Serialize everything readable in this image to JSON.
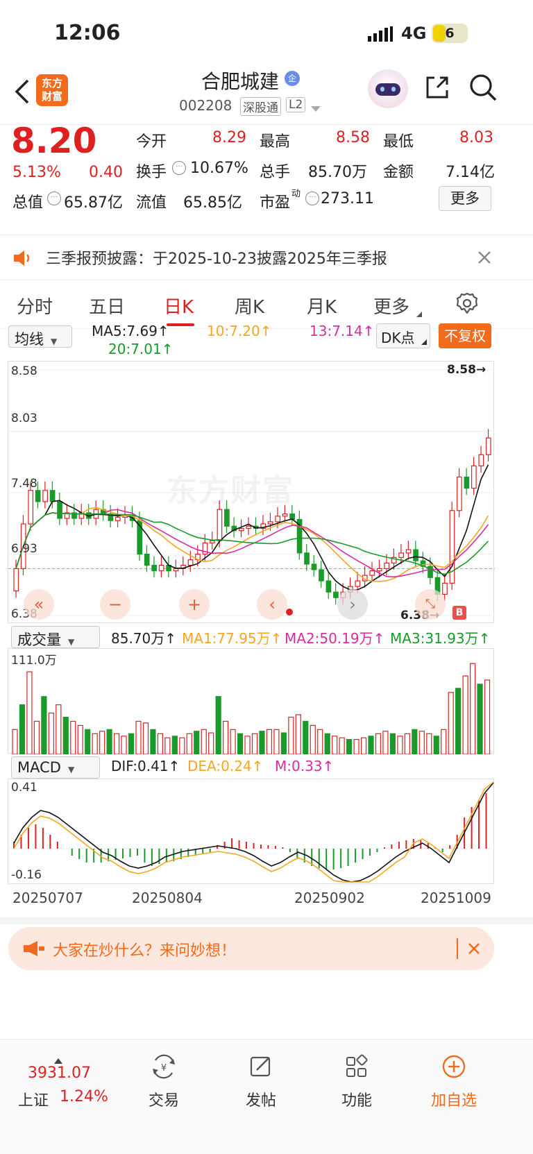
{
  "status_bar": {
    "time": "12:06",
    "network": "4G",
    "battery": "6"
  },
  "header": {
    "logo_text": "东方\n财富",
    "stock_name": "合肥城建",
    "badge": "企",
    "stock_code": "002208",
    "tag1": "深股通",
    "tag2": "L2"
  },
  "quote": {
    "price": "8.20",
    "change_pct": "5.13%",
    "change_amt": "0.40",
    "open_label": "今开",
    "open": "8.29",
    "high_label": "最高",
    "high": "8.58",
    "low_label": "最低",
    "low": "8.03",
    "turnover_label": "换手",
    "turnover": "10.67%",
    "volume_label": "总手",
    "volume": "85.70万",
    "amount_label": "金额",
    "amount": "7.14亿",
    "mktcap_label": "总值",
    "mktcap": "65.87亿",
    "float_label": "流值",
    "float": "65.85亿",
    "pe_label": "市盈",
    "pe_sup": "动",
    "pe": "273.11",
    "more_btn": "更多"
  },
  "notice": {
    "text": "三季报预披露：于2025-10-23披露2025年三季报"
  },
  "tabs": [
    "分时",
    "五日",
    "日K",
    "周K",
    "月K",
    "更多"
  ],
  "active_tab": 2,
  "ma_row": {
    "dropdown": "均线",
    "ma5": "MA5:7.69↑",
    "ma10": "10:7.20↑",
    "ma13": "13:7.14↑",
    "ma20": "20:7.01↑",
    "dk_btn": "DK点",
    "fq_btn": "不复权"
  },
  "kline": {
    "y_labels": [
      "8.58",
      "8.03",
      "7.48",
      "6.93",
      "6.38"
    ],
    "high_mark": "8.58→",
    "low_mark": "6.38→",
    "watermark": "东方财富",
    "b_marker": "B"
  },
  "volume_panel": {
    "dropdown": "成交量",
    "vol": "85.70万↑",
    "ma1": "MA1:77.95万↑",
    "ma2": "MA2:50.19万↑",
    "ma3": "MA3:31.93万↑",
    "y_max": "111.0万"
  },
  "macd_panel": {
    "dropdown": "MACD",
    "dif": "DIF:0.41↑",
    "dea": "DEA:0.24↑",
    "m": "M:0.33↑",
    "y_max": "0.41",
    "y_min": "-0.16"
  },
  "dates": [
    "20250707",
    "20250804",
    "20250902",
    "20251009"
  ],
  "ask_banner": {
    "text": "大家在炒什么？来问妙想！"
  },
  "bottom_nav": {
    "index_value": "3931.07",
    "index_name": "上证",
    "index_pct": "1.24%",
    "items": [
      "交易",
      "发帖",
      "功能",
      "加自选"
    ]
  },
  "colors": {
    "up": "#e02020",
    "down": "#1a9a2a",
    "accent": "#f26a1b"
  }
}
